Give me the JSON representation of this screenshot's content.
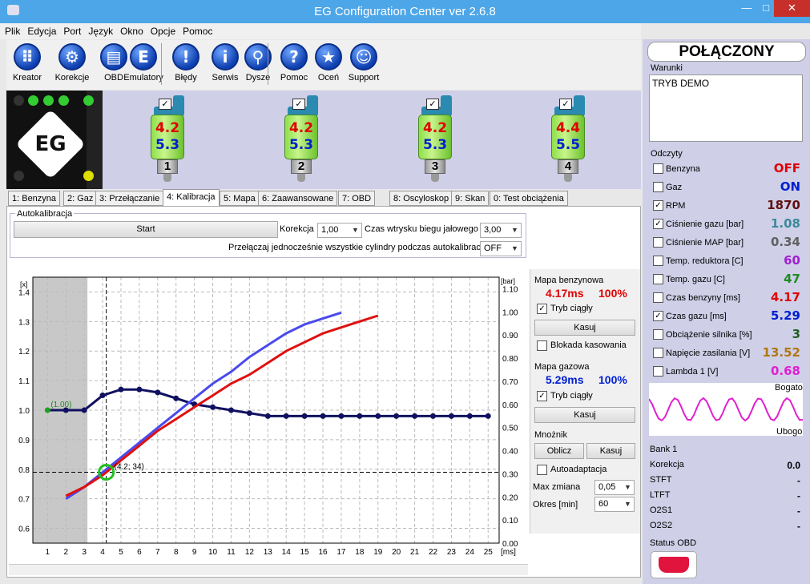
{
  "window": {
    "title": "EG Configuration Center ver 2.6.8"
  },
  "menu": [
    "Plik",
    "Edycja",
    "Port",
    "Język",
    "Okno",
    "Opcje",
    "Pomoc"
  ],
  "toolbar": [
    {
      "label": "Kreator",
      "icon": "keypad-icon",
      "glyph": "⠿"
    },
    {
      "label": "Korekcje",
      "icon": "gear-icon",
      "glyph": "⚙"
    },
    {
      "label": "OBD",
      "icon": "obd-connector-icon",
      "glyph": "▤"
    },
    {
      "label": "Emulatory",
      "icon": "emulator-icon",
      "glyph": "E"
    },
    {
      "label": "Błędy",
      "icon": "error-icon",
      "glyph": "!"
    },
    {
      "label": "Serwis",
      "icon": "info-icon",
      "glyph": "i"
    },
    {
      "label": "Dysze",
      "icon": "nozzle-icon",
      "glyph": "⚲"
    },
    {
      "label": "Pomoc",
      "icon": "help-icon",
      "glyph": "?"
    },
    {
      "label": "Oceń",
      "icon": "star-icon",
      "glyph": "★"
    },
    {
      "label": "Support",
      "icon": "support-icon",
      "glyph": "☺"
    }
  ],
  "injectors": [
    {
      "num": "1",
      "v1": "4.2",
      "v2": "5.3"
    },
    {
      "num": "2",
      "v1": "4.2",
      "v2": "5.3"
    },
    {
      "num": "3",
      "v1": "4.2",
      "v2": "5.3"
    },
    {
      "num": "4",
      "v1": "4.4",
      "v2": "5.5"
    }
  ],
  "tabs": [
    "1: Benzyna",
    "2: Gaz",
    "3: Przełączanie",
    "4: Kalibracja",
    "5: Mapa",
    "6: Zaawansowane",
    "7: OBD",
    "8: Oscyloskop",
    "9: Skan",
    "0: Test obciążenia"
  ],
  "autocal": {
    "group": "Autokalibracja",
    "start": "Start",
    "korekcja_label": "Korekcja",
    "korekcja_value": "1,00",
    "idle_label": "Czas wtrysku biegu jałowego",
    "idle_value": "3,00",
    "switch_label": "Przełączaj jednocześnie wszystkie cylindry podczas autokalibracji",
    "switch_value": "OFF"
  },
  "chart_data": {
    "type": "line",
    "x": [
      1,
      2,
      3,
      4,
      5,
      6,
      7,
      8,
      9,
      10,
      11,
      12,
      13,
      14,
      15,
      16,
      17,
      18,
      19,
      20,
      21,
      22,
      23,
      24,
      25
    ],
    "xunit": "[ms]",
    "ylabel_left": "[x]",
    "ylabel_right": "[bar]",
    "ylim_left": [
      0.55,
      1.45
    ],
    "ylim_right": [
      0.0,
      1.15
    ],
    "yticks_left": [
      "1.4",
      "1.3",
      "1.2",
      "1.1",
      "1.0",
      "0.9",
      "0.8",
      "0.7",
      "0.6"
    ],
    "yticks_right": [
      "1.10",
      "1.00",
      "0.90",
      "0.80",
      "0.70",
      "0.60",
      "0.50",
      "0.40",
      "0.30",
      "0.20",
      "0.10",
      "0.00"
    ],
    "series": [
      {
        "color": "#101060",
        "x": [
          1,
          2,
          3,
          4,
          5,
          6,
          7,
          8,
          9,
          10,
          11,
          12,
          13,
          14,
          15,
          16,
          17,
          18,
          19,
          20,
          21,
          22,
          23,
          24,
          25
        ],
        "y": [
          1.0,
          1.0,
          1.0,
          1.05,
          1.07,
          1.07,
          1.06,
          1.04,
          1.02,
          1.01,
          1.0,
          0.99,
          0.98,
          0.98,
          0.98,
          0.98,
          0.98,
          0.98,
          0.98,
          0.98,
          0.98,
          0.98,
          0.98,
          0.98,
          0.98
        ]
      },
      {
        "color": "#4a4aee",
        "x": [
          2,
          3,
          4,
          5,
          6,
          7,
          8,
          9,
          10,
          11,
          12,
          13,
          14,
          15,
          16,
          17
        ],
        "y": [
          0.7,
          0.74,
          0.79,
          0.84,
          0.89,
          0.94,
          0.99,
          1.04,
          1.09,
          1.13,
          1.18,
          1.22,
          1.26,
          1.29,
          1.31,
          1.33
        ]
      },
      {
        "color": "#e01010",
        "x": [
          2,
          3,
          4,
          5,
          6,
          7,
          8,
          9,
          10,
          11,
          12,
          13,
          14,
          15,
          16,
          17,
          18,
          19
        ],
        "y": [
          0.71,
          0.74,
          0.78,
          0.83,
          0.88,
          0.93,
          0.97,
          1.01,
          1.05,
          1.09,
          1.12,
          1.16,
          1.2,
          1.23,
          1.26,
          1.28,
          1.3,
          1.32
        ]
      }
    ],
    "shaded_range_x": [
      1,
      3
    ],
    "cursor_x": 4.2,
    "cursor_y": 0.79,
    "annotations": [
      "(1.00)",
      "(4.2; 34)"
    ]
  },
  "side": {
    "mapa_benz": {
      "label": "Mapa benzynowa",
      "ms": "4.17ms",
      "pct": "100%",
      "tryb": "Tryb ciągły",
      "kasuj": "Kasuj",
      "blokada": "Blokada kasowania"
    },
    "mapa_gaz": {
      "label": "Mapa gazowa",
      "ms": "5.29ms",
      "pct": "100%",
      "tryb": "Tryb ciągły",
      "kasuj": "Kasuj"
    },
    "mnoznik": {
      "label": "Mnożnik",
      "oblicz": "Oblicz",
      "kasuj": "Kasuj",
      "autoadapt": "Autoadaptacja",
      "max_label": "Max zmiana",
      "max_value": "0,05",
      "okres_label": "Okres [min]",
      "okres_value": "60"
    }
  },
  "right": {
    "status": "POŁĄCZONY",
    "warunki_label": "Warunki",
    "warunki_text": "TRYB DEMO",
    "odczyty_label": "Odczyty",
    "readings": [
      {
        "label": "Benzyna",
        "value": "OFF",
        "checked": false,
        "color": "#e00000"
      },
      {
        "label": "Gaz",
        "value": "ON",
        "checked": false,
        "color": "#0020d0"
      },
      {
        "label": "RPM",
        "value": "1870",
        "checked": true,
        "color": "#601010"
      },
      {
        "label": "Ciśnienie gazu [bar]",
        "value": "1.08",
        "checked": true,
        "color": "#3a8a9a"
      },
      {
        "label": "Ciśnienie MAP [bar]",
        "value": "0.34",
        "checked": false,
        "color": "#606060"
      },
      {
        "label": "Temp. reduktora [C]",
        "value": "60",
        "checked": false,
        "color": "#a020d0"
      },
      {
        "label": "Temp. gazu [C]",
        "value": "47",
        "checked": false,
        "color": "#208a20"
      },
      {
        "label": "Czas benzyny [ms]",
        "value": "4.17",
        "checked": false,
        "color": "#e00000"
      },
      {
        "label": "Czas gazu [ms]",
        "value": "5.29",
        "checked": true,
        "color": "#0020d0"
      },
      {
        "label": "Obciążenie silnika [%]",
        "value": "3",
        "checked": false,
        "color": "#206020"
      },
      {
        "label": "Napięcie zasilania [V]",
        "value": "13.52",
        "checked": false,
        "color": "#b07810"
      },
      {
        "label": "Lambda 1 [V]",
        "value": "0.68",
        "checked": false,
        "color": "#e020d0"
      }
    ],
    "lambda_rich": "Bogato",
    "lambda_lean": "Ubogo",
    "bank": {
      "label": "Bank 1",
      "rows": [
        {
          "label": "Korekcja",
          "value": "0.0"
        },
        {
          "label": "STFT",
          "value": "-"
        },
        {
          "label": "LTFT",
          "value": "-"
        },
        {
          "label": "O2S1",
          "value": "-"
        },
        {
          "label": "O2S2",
          "value": "-"
        }
      ]
    },
    "obd_label": "Status OBD"
  }
}
